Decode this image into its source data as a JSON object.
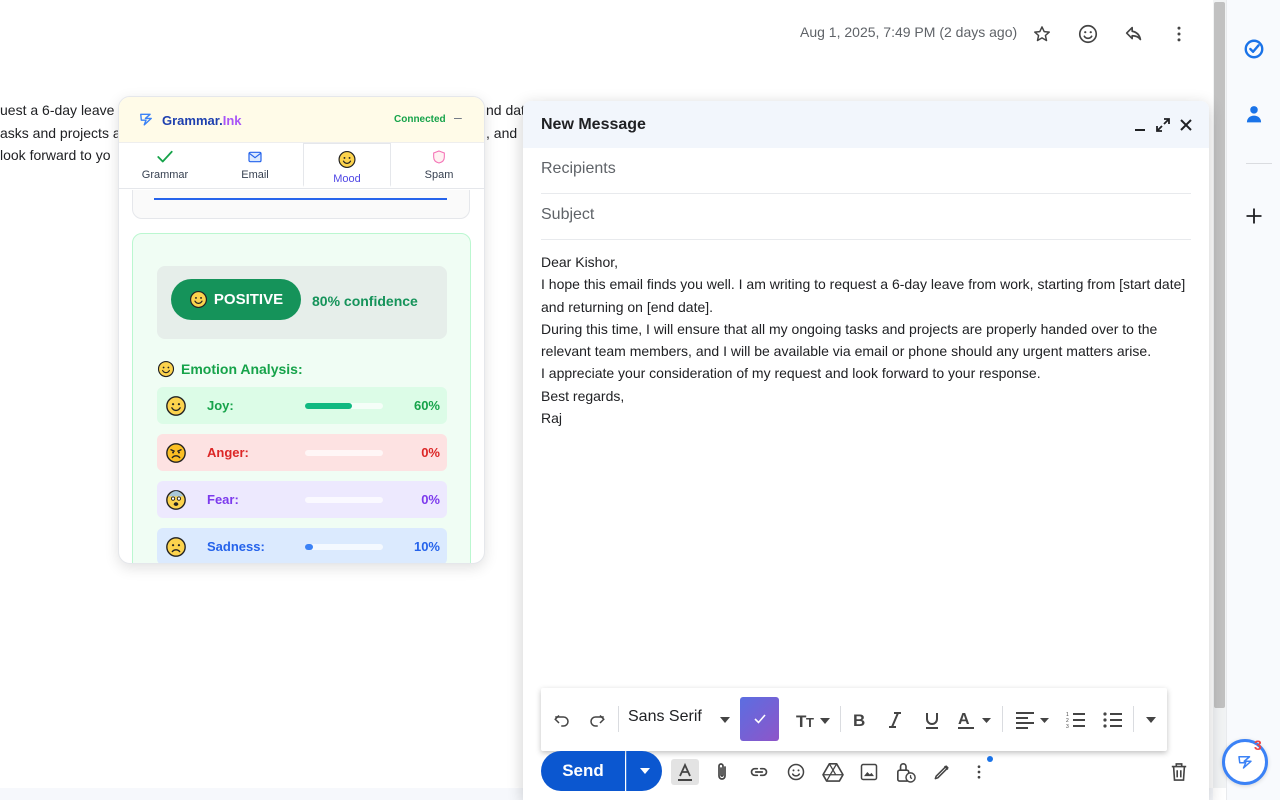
{
  "email": {
    "date": "Aug 1, 2025, 7:49 PM (2 days ago)",
    "bg_lines": [
      "uest a 6-day leave",
      "asks and projects a",
      "look forward to yo"
    ],
    "bg_right_fragments": [
      "nd dat",
      ", and"
    ]
  },
  "grammar_ink": {
    "brand_main": "Grammar.",
    "brand_accent": "Ink",
    "status": "Connected",
    "minimize": "–",
    "tabs": [
      {
        "label": "Grammar",
        "icon": "check-icon"
      },
      {
        "label": "Email",
        "icon": "mail-icon"
      },
      {
        "label": "Mood",
        "icon": "smile-icon"
      },
      {
        "label": "Spam",
        "icon": "shield-icon"
      }
    ],
    "active_tab": "Mood",
    "sentiment": {
      "label": "POSITIVE",
      "confidence": "80% confidence"
    },
    "emotion_title": "Emotion Analysis:",
    "emotions": [
      {
        "name": "Joy:",
        "value": 60,
        "pct": "60%",
        "color": "#16a34a",
        "bar": "#10b981",
        "bg": "#dcfce7"
      },
      {
        "name": "Anger:",
        "value": 0,
        "pct": "0%",
        "color": "#dc2626",
        "bar": "#ef4444",
        "bg": "#fde2e2"
      },
      {
        "name": "Fear:",
        "value": 0,
        "pct": "0%",
        "color": "#7c3aed",
        "bar": "#8b5cf6",
        "bg": "#ede9fe"
      },
      {
        "name": "Sadness:",
        "value": 10,
        "pct": "10%",
        "color": "#2563eb",
        "bar": "#3b82f6",
        "bg": "#dbeafe"
      }
    ]
  },
  "compose": {
    "title": "New Message",
    "recipients_placeholder": "Recipients",
    "subject_placeholder": "Subject",
    "body": [
      "Dear Kishor,",
      "I hope this email finds you well. I am writing to request a 6-day leave from work, starting from [start date] and returning on [end date].",
      "During this time, I will ensure that all my ongoing tasks and projects are properly handed over to the relevant team members, and I will be available via email or phone should any urgent matters arise.",
      "I appreciate your consideration of my request and look forward to your response.",
      "Best regards,",
      "Raj"
    ],
    "font": "Sans Serif",
    "send": "Send"
  },
  "side": {
    "fab_badge": "3"
  },
  "colors": {
    "send_blue": "#0b57d0",
    "positive_green": "#15935a",
    "compose_header": "#f2f6fc"
  }
}
